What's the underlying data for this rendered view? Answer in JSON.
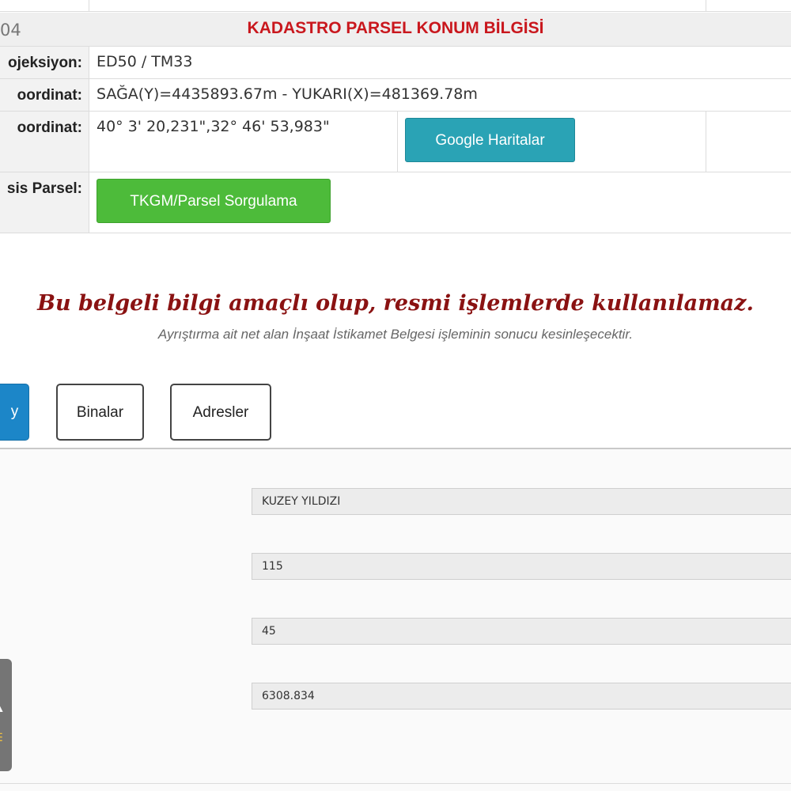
{
  "header": {
    "code": "04",
    "title": "KADASTRO PARSEL KONUM BİLGİSİ"
  },
  "info_rows": [
    {
      "label": "ojeksiyon:",
      "value": "ED50 / TM33"
    },
    {
      "label": "oordinat:",
      "value": "SAĞA(Y)=4435893.67m - YUKARI(X)=481369.78m"
    },
    {
      "label": "oordinat:",
      "value": "40° 3' 20,231\",32° 46' 53,983\""
    },
    {
      "label": "sis Parsel:",
      "value": ""
    }
  ],
  "buttons": {
    "google_maps": "Google Haritalar",
    "tkgm_query": "TKGM/Parsel Sorgulama"
  },
  "notice": {
    "main": "Bu belgeli bilgi amaçlı olup, resmi işlemlerde kullanılamaz.",
    "sub": "Ayrıştırma ait net alan İnşaat İstikamet Belgesi işleminin sonucu kesinleşecektir."
  },
  "tabs": [
    {
      "label": "y",
      "active": true
    },
    {
      "label": "Binalar",
      "active": false
    },
    {
      "label": "Adresler",
      "active": false
    }
  ],
  "fields": [
    {
      "value": "KUZEY YILDIZI"
    },
    {
      "value": "115"
    },
    {
      "value": "45"
    },
    {
      "value": "6308.834"
    }
  ],
  "colors": {
    "title_red": "#c9171d",
    "notice_red": "#8a1212",
    "google_teal": "#2aa3b5",
    "tkgm_green": "#4dbb3a",
    "tab_active_blue": "#1c86c8"
  }
}
